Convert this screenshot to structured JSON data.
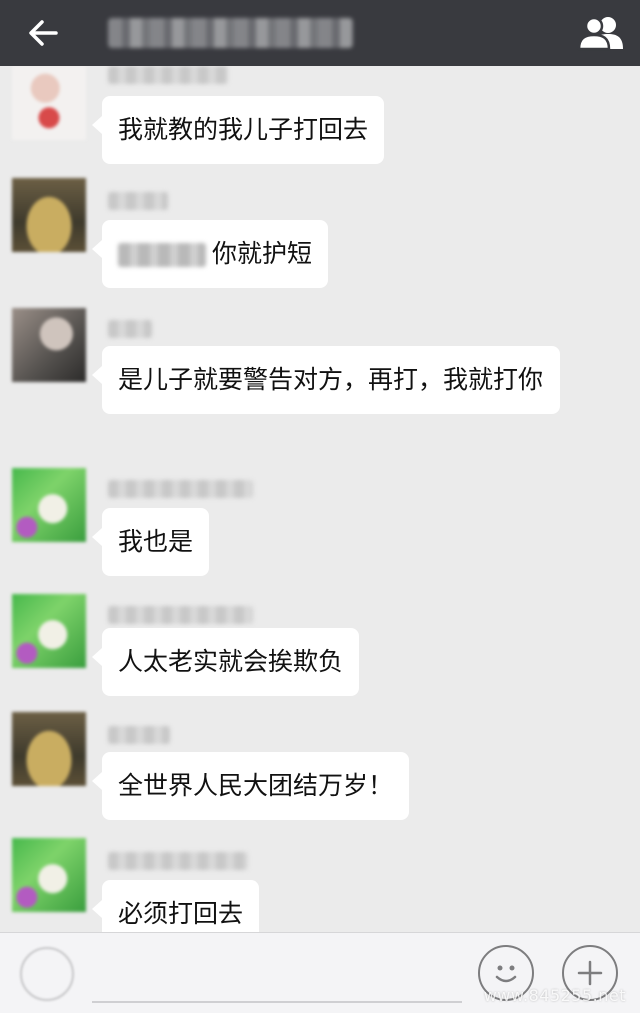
{
  "header": {
    "back_icon": "arrow-left-icon",
    "group_icon": "group-members-icon"
  },
  "messages": [
    {
      "avatar": "av-white",
      "text": "我就教的我儿子打回去"
    },
    {
      "avatar": "av-brown",
      "text": "你就护短"
    },
    {
      "avatar": "av-gray",
      "text": "是儿子就要警告对方，再打，我就打你"
    },
    {
      "avatar": "av-green",
      "text": "我也是"
    },
    {
      "avatar": "av-green",
      "text": "人太老实就会挨欺负"
    },
    {
      "avatar": "av-brown",
      "text": "全世界人民大团结万岁！"
    },
    {
      "avatar": "av-green",
      "text": "必须打回去"
    }
  ],
  "footer": {
    "voice_icon": "voice-icon",
    "emoji_icon": "emoji-icon",
    "plus_icon": "plus-icon",
    "watermark": "www.845255.net"
  },
  "colors": {
    "topbar": "#393a3f",
    "chat_bg": "#ebebeb",
    "bubble": "#ffffff"
  }
}
